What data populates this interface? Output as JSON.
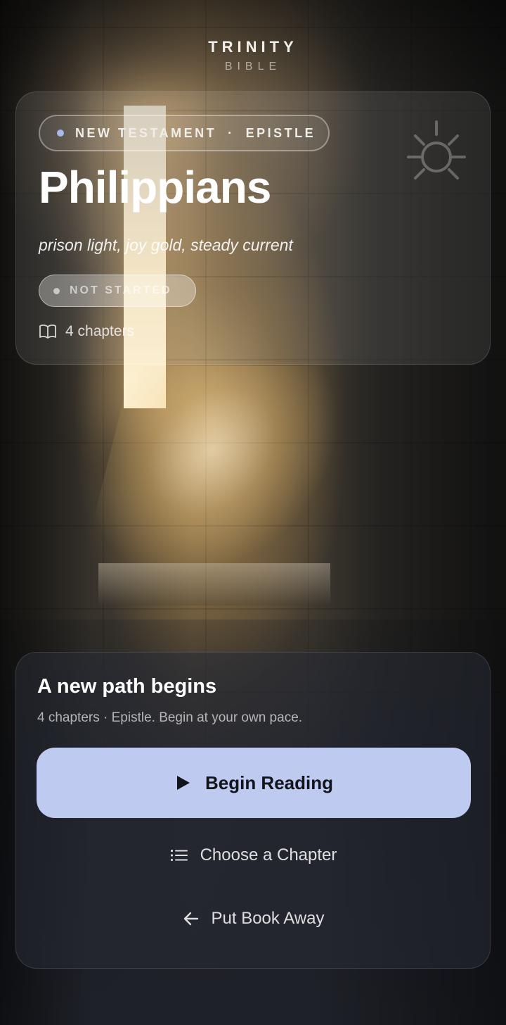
{
  "brand": {
    "title": "TRINITY",
    "subtitle": "BIBLE"
  },
  "book": {
    "category": "NEW TESTAMENT",
    "separator": "·",
    "genre": "EPISTLE",
    "title": "Philippians",
    "tagline": "prison light, joy gold, steady current",
    "status": "NOT STARTED",
    "chapters_label": "4 chapters"
  },
  "start_panel": {
    "heading": "A new path begins",
    "description": "4 chapters · Epistle. Begin at your own pace.",
    "primary_button": "Begin Reading",
    "choose_chapter": "Choose a Chapter",
    "put_away": "Put Book Away"
  },
  "colors": {
    "accent": "#bfcaf0",
    "dot": "#aab7ea",
    "text": "#ffffff"
  },
  "icons": [
    "sun-icon",
    "book-open-icon",
    "play-icon",
    "list-icon",
    "arrow-left-icon"
  ]
}
